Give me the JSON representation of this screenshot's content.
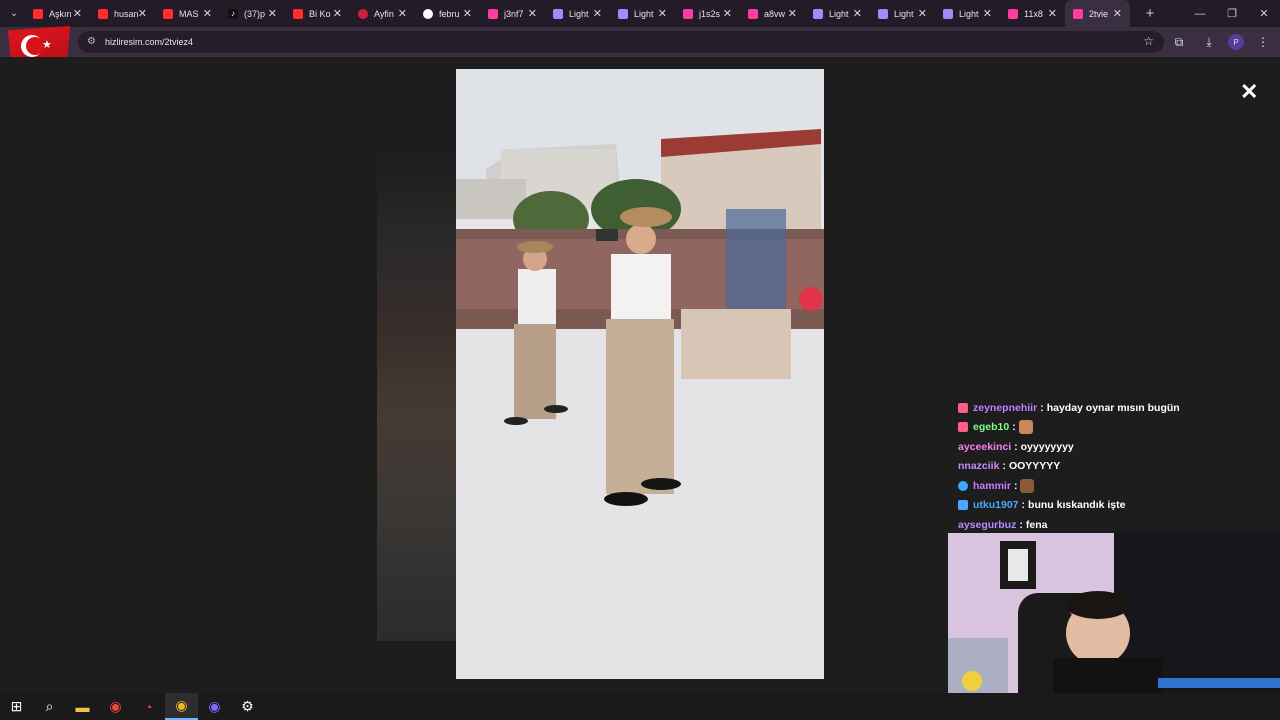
{
  "tabs": [
    {
      "title": "Aşkın",
      "icon": "youtube-icon",
      "color": "#ff2d2d"
    },
    {
      "title": "husan",
      "icon": "youtube-icon",
      "color": "#ff2d2d"
    },
    {
      "title": "MAS",
      "icon": "youtube-icon",
      "color": "#ff2d2d"
    },
    {
      "title": "(37)p",
      "icon": "tiktok-icon",
      "color": "#ffffff"
    },
    {
      "title": "Bi Ko",
      "icon": "youtube-icon",
      "color": "#ff2d2d"
    },
    {
      "title": "Ayfin",
      "icon": "site-icon",
      "color": "#d02040"
    },
    {
      "title": "febru",
      "icon": "google-icon",
      "color": "#ffffff"
    },
    {
      "title": "j3nf7",
      "icon": "hash-icon",
      "color": "#ff3da0"
    },
    {
      "title": "Light",
      "icon": "feather-icon",
      "color": "#9e8cff"
    },
    {
      "title": "Light",
      "icon": "feather-icon",
      "color": "#9e8cff"
    },
    {
      "title": "j1s2s",
      "icon": "hash-icon",
      "color": "#ff3da0"
    },
    {
      "title": "a8vw",
      "icon": "hash-icon",
      "color": "#ff3da0"
    },
    {
      "title": "Light",
      "icon": "feather-icon",
      "color": "#9e8cff"
    },
    {
      "title": "Light",
      "icon": "feather-icon",
      "color": "#9e8cff"
    },
    {
      "title": "Light",
      "icon": "feather-icon",
      "color": "#9e8cff"
    },
    {
      "title": "11x8",
      "icon": "hash-icon",
      "color": "#ff3da0"
    },
    {
      "title": "2tvie",
      "icon": "hash-icon",
      "color": "#ff3da0",
      "active": true
    }
  ],
  "address": {
    "url": "hizliresim.com/2tviez4"
  },
  "chat": [
    {
      "user": "zeynepnehiir",
      "sep": ":",
      "text": "hayday oynar mısın bugün",
      "userColor": "#c77dff",
      "badgeColor": "#ff5c8a"
    },
    {
      "user": "egeb10",
      "sep": ":",
      "text": "",
      "userColor": "#7dff7d",
      "badgeColor": "#ff5c8a",
      "emote": true
    },
    {
      "user": "ayceekinci",
      "sep": ":",
      "text": "oyyyyyyyy",
      "userColor": "#ff7df0",
      "badgeColor": ""
    },
    {
      "user": "nnazciik",
      "sep": ":",
      "text": "OOYYYYY",
      "userColor": "#c58cff",
      "badgeColor": ""
    },
    {
      "user": "hammir",
      "sep": ":",
      "text": "",
      "userColor": "#c77dff",
      "badgeColor": "#3aa8ff",
      "emote": true
    },
    {
      "user": "utku1907",
      "sep": ":",
      "text": "bunu kıskandık işte",
      "userColor": "#4da6ff",
      "badgeColor": "#4da6ff"
    },
    {
      "user": "aysegurbuz",
      "sep": ":",
      "text": "fena",
      "userColor": "#b38cff",
      "badgeColor": ""
    }
  ]
}
